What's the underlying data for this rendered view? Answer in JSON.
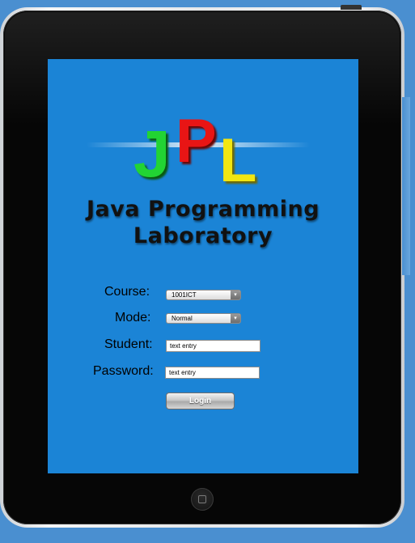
{
  "logo": {
    "letters": [
      "J",
      "P",
      "L"
    ],
    "colors": {
      "j": "#22d433",
      "p": "#e81515",
      "l": "#f2e611"
    },
    "subtitle_line1": "Java Programming",
    "subtitle_line2": "Laboratory"
  },
  "form": {
    "course_label": "Course:",
    "course_value": "1001ICT",
    "mode_label": "Mode:",
    "mode_value": "Normal",
    "student_label": "Student:",
    "student_value": "text entry",
    "password_label": "Password:",
    "password_value": "text entry",
    "login_label": "Login"
  },
  "device": {
    "home_button_icon": "home-button-square-icon"
  },
  "colors": {
    "screen_background": "#1b84d6",
    "page_background": "#4a8fd0",
    "bezel": "#060606"
  }
}
